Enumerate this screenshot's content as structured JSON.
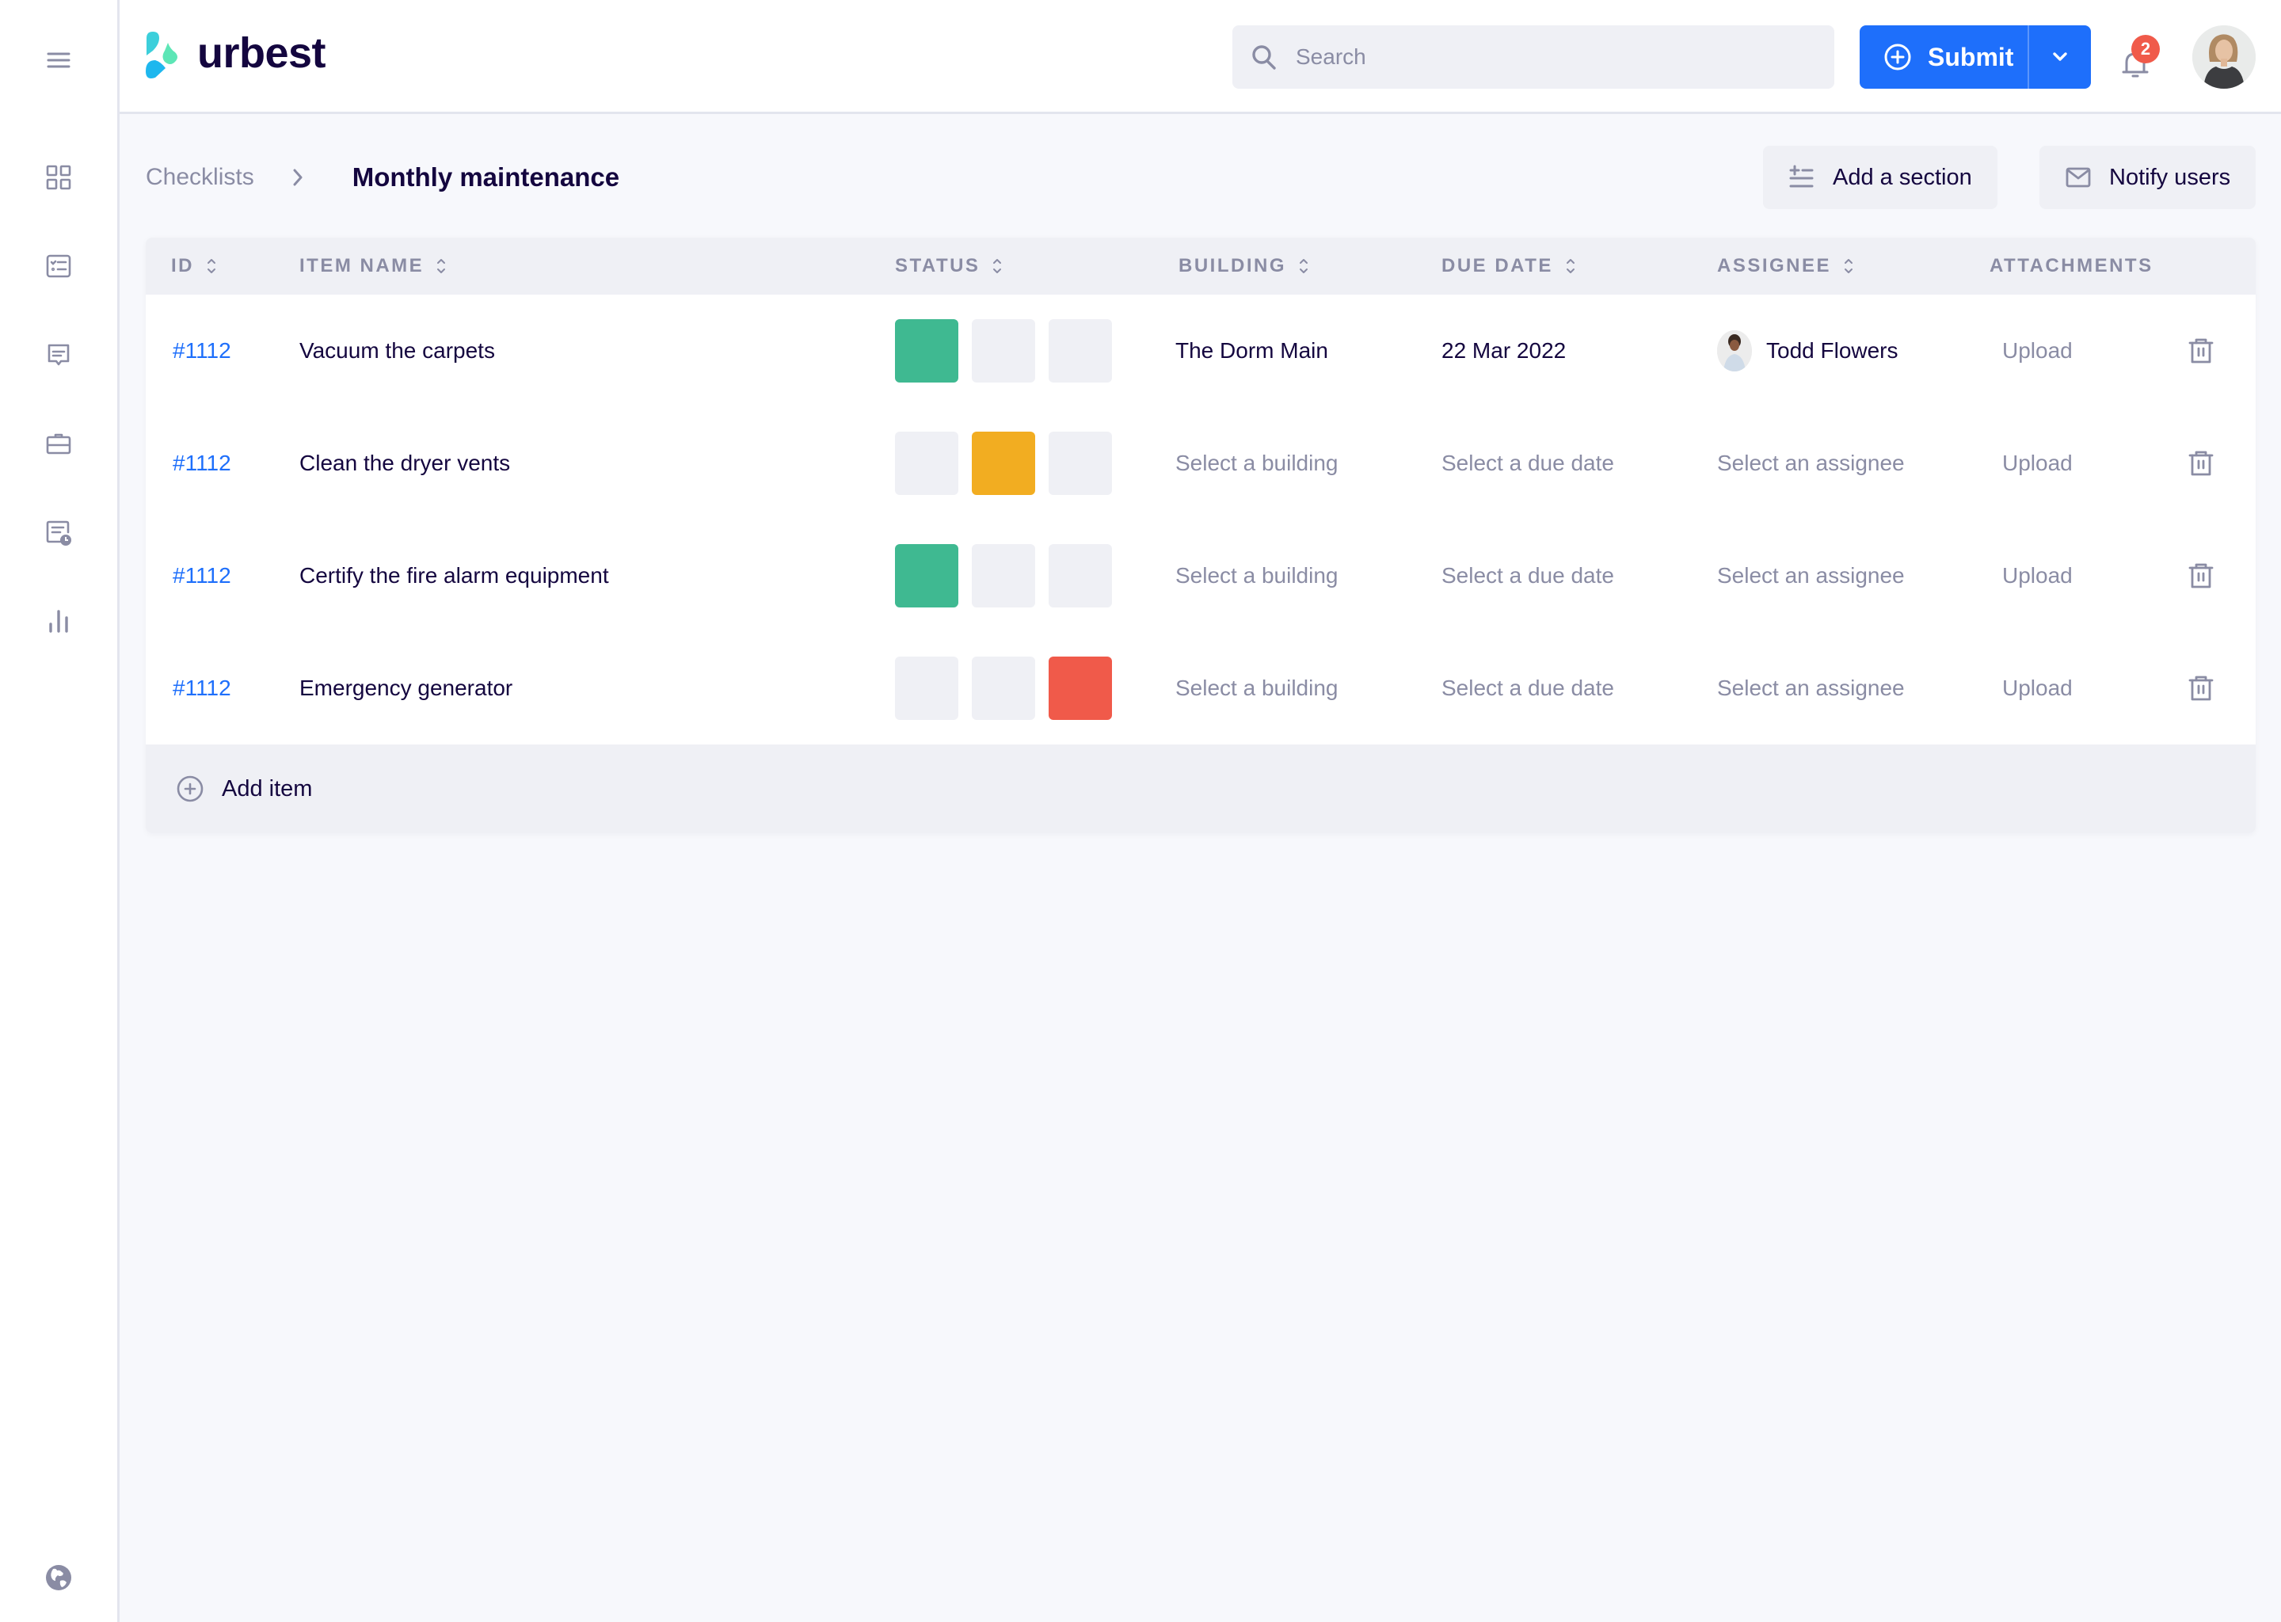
{
  "app": {
    "brand": "urbest",
    "brand_colors": {
      "teal": "#3ccfdb",
      "green": "#5de6b6",
      "blue": "#1eb7ee",
      "dark": "#14063f"
    }
  },
  "sidebar": {
    "items": [
      {
        "name": "menu",
        "icon": "hamburger-menu-icon"
      },
      {
        "name": "dashboard",
        "icon": "grid-icon"
      },
      {
        "name": "checklists",
        "icon": "checklist-icon"
      },
      {
        "name": "messages",
        "icon": "message-icon"
      },
      {
        "name": "work",
        "icon": "briefcase-icon"
      },
      {
        "name": "schedule",
        "icon": "scheduled-document-icon"
      },
      {
        "name": "analytics",
        "icon": "bar-chart-icon"
      }
    ],
    "footer_icon": "globe-icon"
  },
  "header": {
    "search_placeholder": "Search",
    "submit_label": "Submit",
    "notifications_count": "2",
    "colors": {
      "primary": "#1e6ffb",
      "badge": "#f05a4a"
    }
  },
  "breadcrumb": {
    "parent": "Checklists",
    "current": "Monthly maintenance"
  },
  "actions": {
    "add_section": "Add a section",
    "notify_users": "Notify users"
  },
  "table": {
    "columns": [
      {
        "label": "ID",
        "sortable": true
      },
      {
        "label": "ITEM NAME",
        "sortable": true
      },
      {
        "label": "STATUS",
        "sortable": true
      },
      {
        "label": "BUILDING",
        "sortable": true
      },
      {
        "label": "DUE DATE",
        "sortable": true
      },
      {
        "label": "ASSIGNEE",
        "sortable": true
      },
      {
        "label": "ATTACHMENTS",
        "sortable": false
      }
    ],
    "status_colors": {
      "done": "#3fb991",
      "in_progress": "#f2ad21",
      "blocked": "#f05a4a",
      "empty": "#eff0f5"
    },
    "rows": [
      {
        "id": "#1112",
        "name": "Vacuum the carpets",
        "status": "done",
        "building": "The Dorm Main",
        "building_set": true,
        "due_date": "22 Mar 2022",
        "due_set": true,
        "assignee": "Todd Flowers",
        "assignee_set": true,
        "attachments": "Upload"
      },
      {
        "id": "#1112",
        "name": "Clean the dryer vents",
        "status": "in_progress",
        "building": "Select a building",
        "building_set": false,
        "due_date": "Select a due date",
        "due_set": false,
        "assignee": "Select an assignee",
        "assignee_set": false,
        "attachments": "Upload"
      },
      {
        "id": "#1112",
        "name": "Certify the fire alarm equipment",
        "status": "done",
        "building": "Select a building",
        "building_set": false,
        "due_date": "Select a due date",
        "due_set": false,
        "assignee": "Select an assignee",
        "assignee_set": false,
        "attachments": "Upload"
      },
      {
        "id": "#1112",
        "name": "Emergency generator",
        "status": "blocked",
        "building": "Select a building",
        "building_set": false,
        "due_date": "Select a due date",
        "due_set": false,
        "assignee": "Select an assignee",
        "assignee_set": false,
        "attachments": "Upload"
      }
    ],
    "add_item_label": "Add item"
  }
}
